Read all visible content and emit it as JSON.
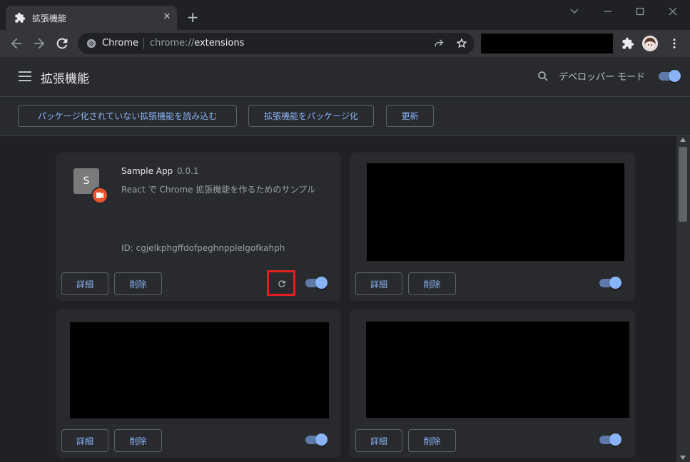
{
  "tab": {
    "title": "拡張機能",
    "close": "✕"
  },
  "newtab": "+",
  "window": {
    "minimize": "﹀",
    "min2": "—",
    "max": "☐",
    "close": "✕"
  },
  "omnibox": {
    "site_label": "Chrome",
    "url_prefix": "chrome://",
    "url_path": "extensions"
  },
  "header": {
    "title": "拡張機能",
    "dev_mode_label": "デベロッパー モード",
    "dev_mode_on": true
  },
  "actions": {
    "load_unpacked": "パッケージ化されていない拡張機能を読み込む",
    "pack": "拡張機能をパッケージ化",
    "update": "更新"
  },
  "extension": {
    "icon_letter": "S",
    "name": "Sample App",
    "version": "0.0.1",
    "description": "React で Chrome 拡張機能を作るためのサンプル",
    "id_text": "ID: cgjelkphgffdofpeghnpplelgofkahph"
  },
  "card_buttons": {
    "details": "詳細",
    "remove": "削除"
  },
  "colors": {
    "accent": "#8ab4f8",
    "highlight": "#e02020",
    "badge": "#e8542a"
  }
}
